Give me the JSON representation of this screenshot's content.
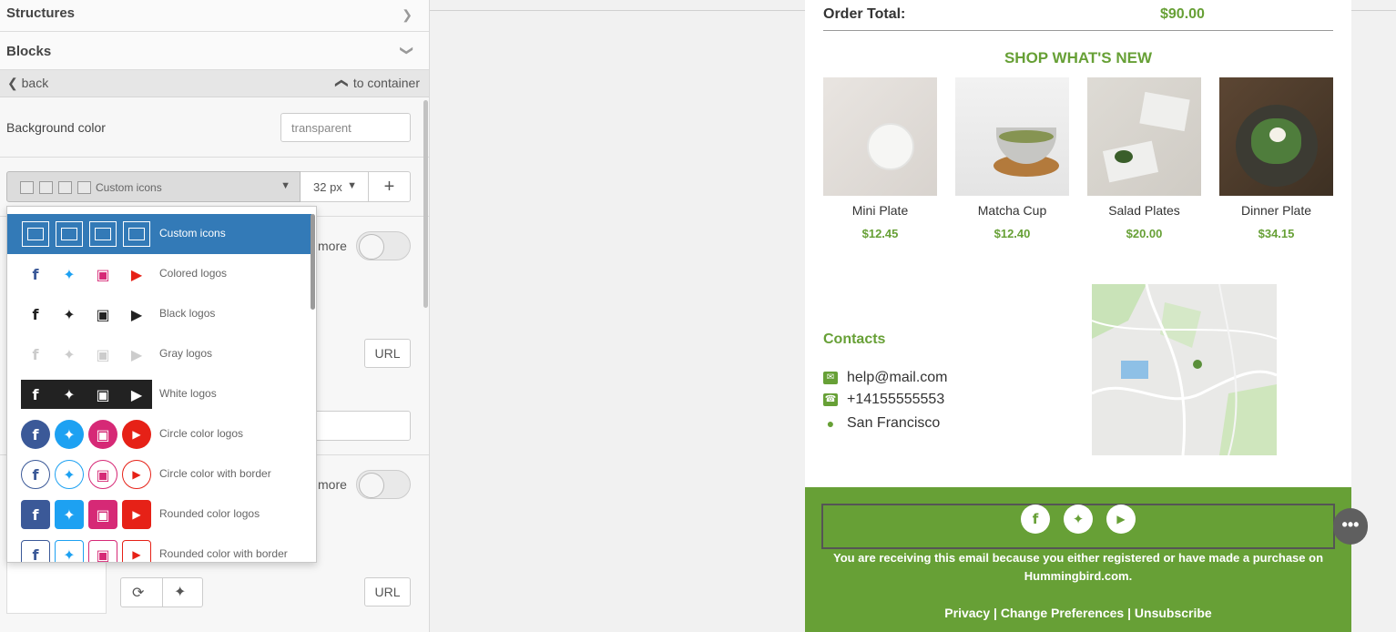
{
  "sidebar": {
    "structures": "Structures",
    "blocks": "Blocks",
    "back": "back",
    "to_container": "to container",
    "background_color_label": "Background color",
    "background_color_value": "transparent",
    "icon_set_selected": "Custom icons",
    "icon_size": "32 px",
    "more_label_1": "more",
    "more_label_2": "more",
    "url_label_1": "URL",
    "url_label_2": "URL"
  },
  "dropdown": {
    "options": [
      {
        "label": "Custom icons",
        "style": "custom"
      },
      {
        "label": "Colored logos",
        "style": "colored"
      },
      {
        "label": "Black logos",
        "style": "black"
      },
      {
        "label": "Gray logos",
        "style": "gray"
      },
      {
        "label": "White logos",
        "style": "white"
      },
      {
        "label": "Circle color logos",
        "style": "circle"
      },
      {
        "label": "Circle color with border",
        "style": "circle-border"
      },
      {
        "label": "Rounded color logos",
        "style": "rounded"
      },
      {
        "label": "Rounded color with border",
        "style": "rounded-border"
      }
    ]
  },
  "email": {
    "order_total_label": "Order Total:",
    "order_total_value": "$90.00",
    "shop_heading": "SHOP WHAT'S NEW",
    "products": [
      {
        "name": "Mini Plate",
        "price": "$12.45"
      },
      {
        "name": "Matcha Cup",
        "price": "$12.40"
      },
      {
        "name": "Salad Plates",
        "price": "$20.00"
      },
      {
        "name": "Dinner Plate",
        "price": "$34.15"
      }
    ],
    "contacts_heading": "Contacts",
    "contact_email": "help@mail.com",
    "contact_phone": "+14155555553",
    "contact_city": "San Francisco",
    "footer_text_1": "You are receiving this email because you either registered or have made a purchase on",
    "footer_text_2": "Hummingbird.com.",
    "footer_links": "Privacy | Change Preferences | Unsubscribe",
    "more_button": "•••"
  },
  "colors": {
    "accent_green": "#67a036",
    "selected_blue": "#337ab7",
    "facebook": "#3b5998",
    "twitter": "#1da1f2",
    "instagram": "#d62976",
    "youtube": "#e62117"
  }
}
